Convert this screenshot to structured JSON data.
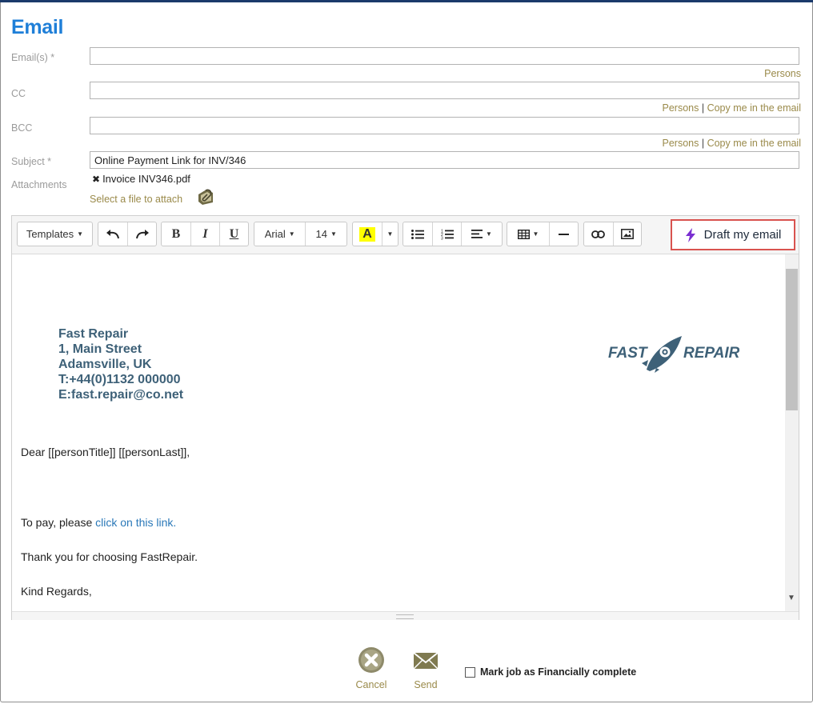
{
  "dialog": {
    "title": "Email"
  },
  "fields": {
    "emails": {
      "label": "Email(s) *",
      "value": ""
    },
    "cc": {
      "label": "CC",
      "value": ""
    },
    "bcc": {
      "label": "BCC",
      "value": ""
    },
    "subject": {
      "label": "Subject *",
      "value": "Online Payment Link for INV/346"
    }
  },
  "links": {
    "persons": "Persons",
    "separator": "|",
    "copy_me": "Copy me in the email"
  },
  "attachments": {
    "label": "Attachments",
    "items": [
      {
        "name": "Invoice INV346.pdf"
      }
    ],
    "select_file": "Select a file to attach"
  },
  "toolbar": {
    "templates": "Templates",
    "bold": "B",
    "italic": "I",
    "underline": "U",
    "font": "Arial",
    "size": "14",
    "highlight": "A",
    "draft": "Draft my email",
    "highlight_color": "#ffff00",
    "draft_icon_color": "#7a2fd1"
  },
  "body": {
    "company": "Fast Repair",
    "address1": "1, Main Street",
    "address2": "Adamsville, UK",
    "phone": "T:+44(0)1132 000000",
    "email": "E:fast.repair@co.net",
    "logo_left": "FAST",
    "logo_right": "REPAIR",
    "greeting": "Dear [[personTitle]] [[personLast]],",
    "pay_prefix": "To pay, please ",
    "pay_link": "click on this link.",
    "thanks": "Thank you for choosing FastRepair.",
    "regards": "Kind Regards,"
  },
  "footer": {
    "cancel": "Cancel",
    "send": "Send",
    "financial": "Mark job as Financially complete"
  }
}
